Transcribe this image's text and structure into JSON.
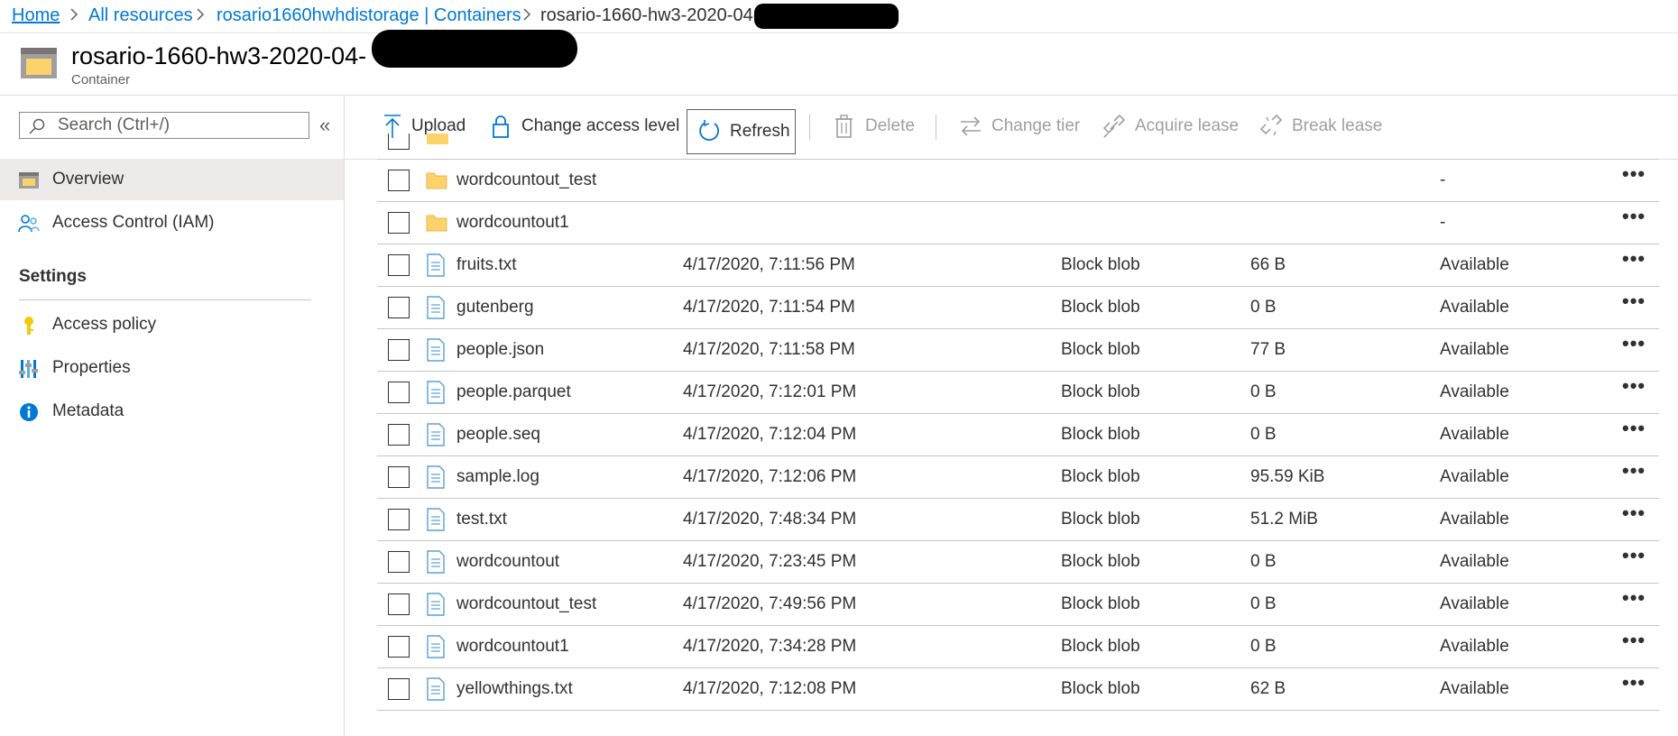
{
  "breadcrumb": {
    "home": "Home",
    "all_resources": "All resources",
    "storage": "rosario1660hwhdistorage | Containers",
    "current": "rosario-1660-hw3-2020-04-"
  },
  "header": {
    "title": "rosario-1660-hw3-2020-04-",
    "subtitle": "Container"
  },
  "sidebar": {
    "search_placeholder": "Search (Ctrl+/)",
    "collapse": "«",
    "items": [
      {
        "label": "Overview",
        "icon": "overview-icon",
        "active": true
      },
      {
        "label": "Access Control (IAM)",
        "icon": "people-icon",
        "active": false
      }
    ],
    "settings_header": "Settings",
    "settings_items": [
      {
        "label": "Access policy",
        "icon": "key-icon"
      },
      {
        "label": "Properties",
        "icon": "properties-icon"
      },
      {
        "label": "Metadata",
        "icon": "info-icon"
      }
    ]
  },
  "toolbar": {
    "upload": "Upload",
    "change_access": "Change access level",
    "refresh": "Refresh",
    "delete": "Delete",
    "change_tier": "Change tier",
    "acquire_lease": "Acquire lease",
    "break_lease": "Break lease"
  },
  "rows": [
    {
      "kind": "folder",
      "name": "wordcountout_test",
      "modified": "",
      "type": "",
      "size": "",
      "tier": "-"
    },
    {
      "kind": "folder",
      "name": "wordcountout1",
      "modified": "",
      "type": "",
      "size": "",
      "tier": "-"
    },
    {
      "kind": "file",
      "name": "fruits.txt",
      "modified": "4/17/2020, 7:11:56 PM",
      "type": "Block blob",
      "size": "66 B",
      "tier": "Available"
    },
    {
      "kind": "file",
      "name": "gutenberg",
      "modified": "4/17/2020, 7:11:54 PM",
      "type": "Block blob",
      "size": "0 B",
      "tier": "Available"
    },
    {
      "kind": "file",
      "name": "people.json",
      "modified": "4/17/2020, 7:11:58 PM",
      "type": "Block blob",
      "size": "77 B",
      "tier": "Available"
    },
    {
      "kind": "file",
      "name": "people.parquet",
      "modified": "4/17/2020, 7:12:01 PM",
      "type": "Block blob",
      "size": "0 B",
      "tier": "Available"
    },
    {
      "kind": "file",
      "name": "people.seq",
      "modified": "4/17/2020, 7:12:04 PM",
      "type": "Block blob",
      "size": "0 B",
      "tier": "Available"
    },
    {
      "kind": "file",
      "name": "sample.log",
      "modified": "4/17/2020, 7:12:06 PM",
      "type": "Block blob",
      "size": "95.59 KiB",
      "tier": "Available"
    },
    {
      "kind": "file",
      "name": "test.txt",
      "modified": "4/17/2020, 7:48:34 PM",
      "type": "Block blob",
      "size": "51.2 MiB",
      "tier": "Available"
    },
    {
      "kind": "file",
      "name": "wordcountout",
      "modified": "4/17/2020, 7:23:45 PM",
      "type": "Block blob",
      "size": "0 B",
      "tier": "Available"
    },
    {
      "kind": "file",
      "name": "wordcountout_test",
      "modified": "4/17/2020, 7:49:56 PM",
      "type": "Block blob",
      "size": "0 B",
      "tier": "Available"
    },
    {
      "kind": "file",
      "name": "wordcountout1",
      "modified": "4/17/2020, 7:34:28 PM",
      "type": "Block blob",
      "size": "0 B",
      "tier": "Available"
    },
    {
      "kind": "file",
      "name": "yellowthings.txt",
      "modified": "4/17/2020, 7:12:08 PM",
      "type": "Block blob",
      "size": "62 B",
      "tier": "Available"
    }
  ],
  "more_label": "•••",
  "colors": {
    "accent": "#0078d4",
    "folder": "#fcd26b",
    "file": "#5aa0d6"
  }
}
